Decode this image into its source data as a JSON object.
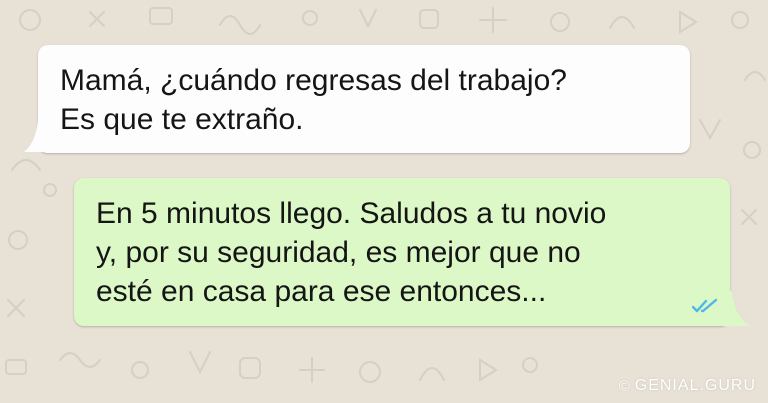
{
  "incoming_message": {
    "lines": [
      "Mamá, ¿cuándo regresas del trabajo?",
      "Es que te extraño."
    ]
  },
  "outgoing_message": {
    "lines": [
      "En 5 minutos llego. Saludos a tu novio",
      "y, por su seguridad, es mejor que no",
      "esté en casa para ese entonces..."
    ],
    "read_receipt_icon": "double-check-icon"
  },
  "watermark": {
    "symbol": "©",
    "text": "GENIAL.GURU"
  },
  "colors": {
    "background": "#e7e1d6",
    "incoming_bubble": "#fdfdfd",
    "outgoing_bubble": "#dcf8c6",
    "read_ticks": "#4fb6ec"
  }
}
